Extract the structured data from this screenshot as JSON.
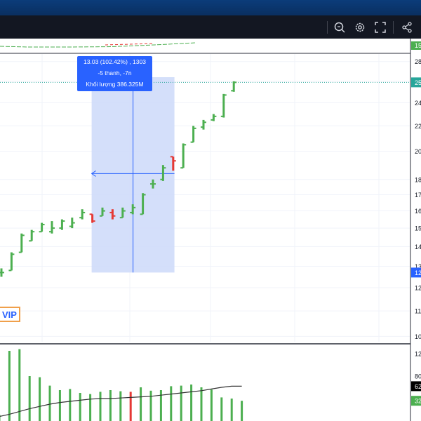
{
  "toolbar": {
    "icons": [
      "zoom-search-icon",
      "settings-gear-icon",
      "fullscreen-icon",
      "share-icon"
    ]
  },
  "measure_tooltip": {
    "line1": "13.03 (102.42%) , 1303",
    "line2": "-5 thanh, -7n",
    "line3": "Khối lượng 386.325M"
  },
  "vip_badge": "VIP",
  "colors": {
    "up": "#4caf50",
    "down": "#e53935",
    "measure_fill": "#cfdcfa",
    "measure_line": "#2962ff",
    "last_price_label": "#26a69a",
    "volume_ma": "#333333",
    "vip_border": "#f0a04b"
  },
  "price_axis": {
    "ticks": [
      "28",
      "26",
      "24",
      "22",
      "20",
      "18",
      "17",
      "16",
      "15",
      "14",
      "13",
      "12",
      "11",
      "10"
    ],
    "last_price_label": "25",
    "measure_price_label": "12"
  },
  "top_indicator_label": "15",
  "volume_axis": {
    "ticks": [
      "12",
      "80",
      "32"
    ],
    "ma_label": "62",
    "last_label": "32"
  },
  "chart_data": [
    {
      "type": "ohlc",
      "y_scale": "log",
      "ylim": [
        9.8,
        28.8
      ],
      "grid": true,
      "bars": [
        {
          "open": 12.7,
          "high": 12.9,
          "low": 12.5,
          "close": 12.7
        },
        {
          "open": 12.8,
          "high": 13.7,
          "low": 12.8,
          "close": 13.6
        },
        {
          "open": 13.7,
          "high": 14.7,
          "low": 13.7,
          "close": 14.6
        },
        {
          "open": 14.3,
          "high": 14.9,
          "low": 14.3,
          "close": 14.8
        },
        {
          "open": 14.8,
          "high": 15.3,
          "low": 14.8,
          "close": 15.2
        },
        {
          "open": 14.8,
          "high": 15.4,
          "low": 14.7,
          "close": 15.0
        },
        {
          "open": 15.0,
          "high": 15.5,
          "low": 14.9,
          "close": 15.4
        },
        {
          "open": 15.1,
          "high": 15.6,
          "low": 15.0,
          "close": 15.3
        },
        {
          "open": 15.6,
          "high": 16.1,
          "low": 15.5,
          "close": 15.9
        },
        {
          "open": 15.8,
          "high": 15.8,
          "low": 15.3,
          "close": 15.4
        },
        {
          "open": 15.7,
          "high": 16.2,
          "low": 15.7,
          "close": 16.0
        },
        {
          "open": 15.9,
          "high": 16.1,
          "low": 15.5,
          "close": 15.7
        },
        {
          "open": 15.6,
          "high": 16.2,
          "low": 15.6,
          "close": 16.0
        },
        {
          "open": 15.9,
          "high": 16.4,
          "low": 15.8,
          "close": 16.2
        },
        {
          "open": 15.8,
          "high": 17.1,
          "low": 15.8,
          "close": 17.0
        },
        {
          "open": 17.7,
          "high": 18.0,
          "low": 17.4,
          "close": 17.7
        },
        {
          "open": 18.0,
          "high": 19.0,
          "low": 17.9,
          "close": 18.8
        },
        {
          "open": 19.6,
          "high": 19.6,
          "low": 18.6,
          "close": 19.3
        },
        {
          "open": 18.8,
          "high": 20.6,
          "low": 18.8,
          "close": 20.5
        },
        {
          "open": 20.7,
          "high": 22.0,
          "low": 20.7,
          "close": 21.8
        },
        {
          "open": 21.9,
          "high": 22.5,
          "low": 21.7,
          "close": 22.3
        },
        {
          "open": 22.5,
          "high": 23.0,
          "low": 22.4,
          "close": 22.8
        },
        {
          "open": 22.8,
          "high": 24.8,
          "low": 22.7,
          "close": 24.7
        },
        {
          "open": 25.1,
          "high": 26.0,
          "low": 25.0,
          "close": 25.9
        }
      ],
      "measure_range": {
        "from_bar": 9,
        "to_bar": 14,
        "from_price": 12.7,
        "to_price": 18.4
      }
    },
    {
      "type": "bar",
      "series": [
        {
          "values": [
            11,
            125,
            128,
            80,
            78,
            63,
            55,
            57,
            50,
            48,
            52,
            55,
            53,
            52,
            60,
            54,
            55,
            62,
            63,
            65,
            60,
            56,
            42,
            40,
            36
          ]
        }
      ],
      "ma": [
        8,
        12,
        17,
        22,
        26,
        30,
        33,
        35,
        37,
        39,
        40,
        40,
        41,
        42,
        43,
        44,
        46,
        48,
        50,
        52,
        54,
        57,
        60,
        62,
        62
      ],
      "down_bars": [
        13
      ],
      "ylim": [
        0,
        130
      ]
    }
  ]
}
